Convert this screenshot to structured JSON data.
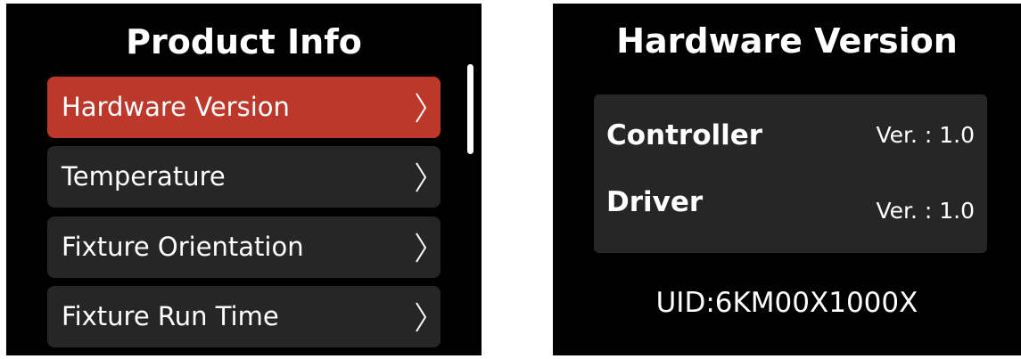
{
  "product_info": {
    "title": "Product Info",
    "items": [
      {
        "label": "Hardware Version"
      },
      {
        "label": "Temperature"
      },
      {
        "label": "Fixture Orientation"
      },
      {
        "label": "Fixture Run Time"
      }
    ]
  },
  "hardware_version": {
    "title": "Hardware Version",
    "controller": {
      "label": "Controller",
      "version": "Ver. :  1.0"
    },
    "driver": {
      "label": "Driver",
      "version": "Ver. :  1.0"
    },
    "uid": "UID:6KM00X1000X"
  },
  "colors": {
    "selected": "#bc382b",
    "item_bg": "#262626",
    "screen_bg": "#000000"
  },
  "icons": {
    "chevron": "chevron-right-icon",
    "scrollbar": "scrollbar-thumb"
  }
}
